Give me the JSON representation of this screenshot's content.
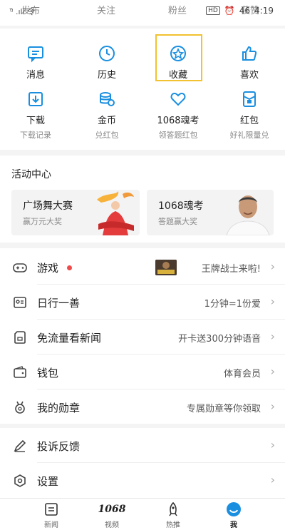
{
  "statusbar": {
    "tabs": [
      "发布",
      "关注",
      "粉丝",
      "获赞"
    ],
    "left": "ᵘ᷈ .ıll 令",
    "hd": "HD",
    "alarm": "⏰",
    "battery": "46",
    "time": "4:19"
  },
  "grid": [
    {
      "label": "消息",
      "sub": "",
      "icon": "message-icon"
    },
    {
      "label": "历史",
      "sub": "",
      "icon": "clock-icon"
    },
    {
      "label": "收藏",
      "sub": "",
      "icon": "star-icon"
    },
    {
      "label": "喜欢",
      "sub": "",
      "icon": "thumbs-up-icon"
    },
    {
      "label": "下载",
      "sub": "下载记录",
      "icon": "download-icon"
    },
    {
      "label": "金币",
      "sub": "兑红包",
      "icon": "coins-icon"
    },
    {
      "label": "1068魂考",
      "sub": "领答题红包",
      "icon": "heart-icon"
    },
    {
      "label": "红包",
      "sub": "好礼限量兑",
      "icon": "red-packet-icon"
    }
  ],
  "activity": {
    "title": "活动中心",
    "cards": [
      {
        "title": "广场舞大赛",
        "sub": "赢万元大奖"
      },
      {
        "title": "1068魂考",
        "sub": "答题赢大奖"
      }
    ]
  },
  "list": [
    {
      "label": "游戏",
      "value": "王牌战士来啦!",
      "icon": "gamepad-icon"
    },
    {
      "label": "日行一善",
      "value": "1分钟=1份爱",
      "icon": "charity-icon"
    },
    {
      "label": "免流量看新闻",
      "value": "开卡送300分钟语音",
      "icon": "sim-card-icon"
    },
    {
      "label": "钱包",
      "value": "体育会员",
      "icon": "wallet-icon"
    },
    {
      "label": "我的勋章",
      "value": "专属勋章等你领取",
      "icon": "medal-icon"
    }
  ],
  "list2": [
    {
      "label": "投诉反馈",
      "value": "",
      "icon": "edit-icon"
    },
    {
      "label": "设置",
      "value": "",
      "icon": "settings-icon"
    }
  ],
  "bottomnav": [
    {
      "label": "新闻",
      "icon": "news-icon"
    },
    {
      "label": "视频",
      "icon": "video-1068-icon",
      "glyph": "1068"
    },
    {
      "label": "热推",
      "icon": "rocket-icon"
    },
    {
      "label": "我",
      "icon": "profile-icon"
    }
  ],
  "colors": {
    "accent": "#1a8fe0",
    "highlight": "#f2c230",
    "dot": "#f04a4a"
  }
}
